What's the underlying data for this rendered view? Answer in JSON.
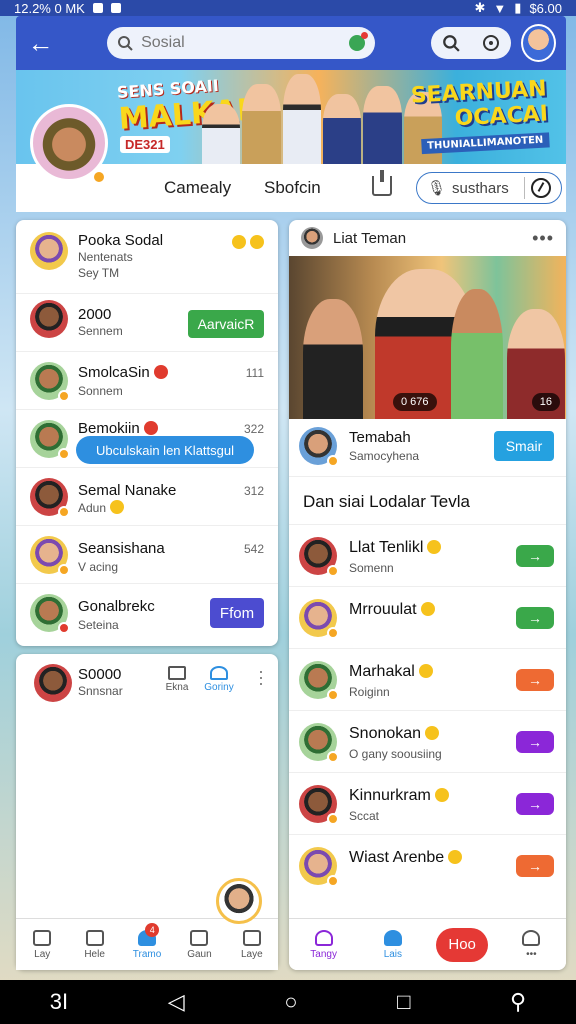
{
  "status_bar": {
    "left_text": "12.2% 0 MK",
    "right_text": "$6.00"
  },
  "header": {
    "search_placeholder": "Sosial"
  },
  "banner": {
    "left_line1": "SENS SOAII",
    "left_line2": "MALKAI!",
    "left_badge": "DE321",
    "right_line1": "SEARNUAN",
    "right_line2": "OCACAI",
    "right_line3": "THUNIALLIMANOTEN"
  },
  "subbar": {
    "tab1": "Camealy",
    "tab2": "Sbofcin",
    "search_text": "susthars"
  },
  "left_list": [
    {
      "name": "Pooka Sodal",
      "sub": "Nentenats",
      "sub2": "Sey TM"
    },
    {
      "name": "2000",
      "sub": "Sennem",
      "button": "AarvaicR"
    },
    {
      "name": "SmolcaSin",
      "sub": "Sonnem",
      "time": "111"
    },
    {
      "name": "Bemokiin",
      "sub": "",
      "time": "322"
    },
    {
      "name": "Semal Nanake",
      "sub": "Adun",
      "time": "312"
    },
    {
      "name": "Seansishana",
      "sub": "V acing",
      "time": "542"
    },
    {
      "name": "Gonalbrekc",
      "sub": "Seteina",
      "button": "Ffom"
    }
  ],
  "tooltip_text": "Ubculskain len Klattsgul",
  "left_panel2": {
    "name": "S0000",
    "sub": "Snnsnar",
    "icon1_label": "Ekna",
    "icon2_label": "Goriny"
  },
  "right_header": {
    "title": "Liat Teman"
  },
  "photo": {
    "pill_left": "0 676",
    "pill_right": "16"
  },
  "invite": {
    "name": "Temabah",
    "sub": "Samocyhena",
    "button": "Smair"
  },
  "section_title": "Dan siai Lodalar Tevla",
  "right_list": [
    {
      "name": "Llat Tenlikl",
      "sub": "Somenn",
      "arrow": "→",
      "color": "#3aa84a"
    },
    {
      "name": "Mrrouulat",
      "sub": "",
      "arrow": "→",
      "color": "#3aa84a"
    },
    {
      "name": "Marhakal",
      "sub": "Roiginn",
      "arrow": "→",
      "color": "#ee6a33"
    },
    {
      "name": "Snonokan",
      "sub": "O gany soousiing",
      "arrow": "→",
      "color": "#8b27d8"
    },
    {
      "name": "Kinnurkram",
      "sub": "Sccat",
      "arrow": "→",
      "color": "#8b27d8"
    },
    {
      "name": "Wiast Arenbe",
      "sub": "",
      "arrow": "→",
      "color": "#ee6a33"
    }
  ],
  "tabbar_left": [
    {
      "label": "Lay"
    },
    {
      "label": "Hele"
    },
    {
      "label": "Tramo",
      "badge": "4"
    },
    {
      "label": "Gaun"
    },
    {
      "label": "Laye"
    }
  ],
  "tabbar_right": [
    {
      "label": "Tangy"
    },
    {
      "label": "Lais"
    },
    {
      "label": "Hoo"
    },
    {
      "label": ""
    }
  ],
  "android_nav": {
    "recent": "3I"
  }
}
